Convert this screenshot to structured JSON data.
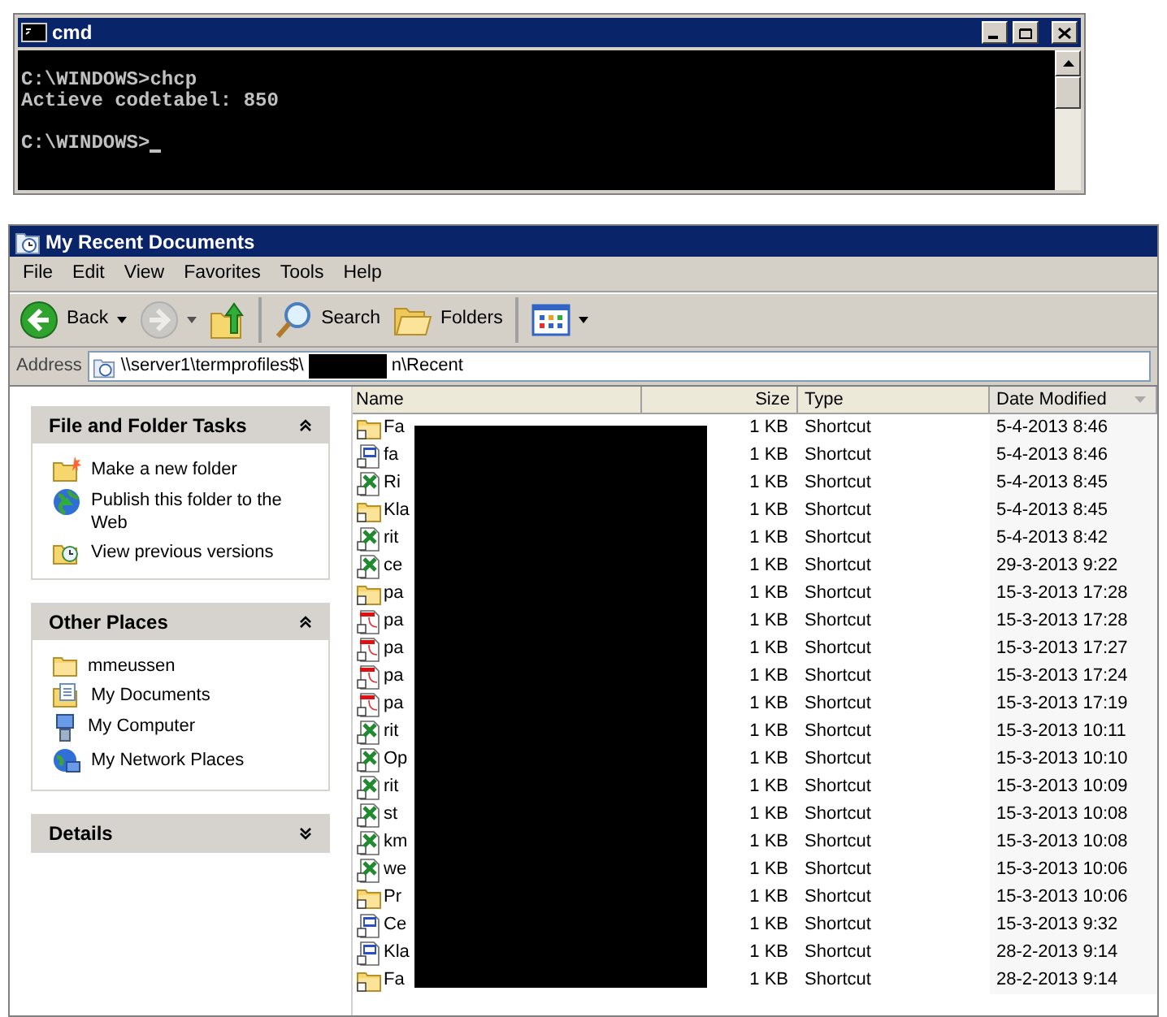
{
  "console": {
    "title": "cmd",
    "blocks": [
      [
        "C:\\WINDOWS>chcp",
        "Actieve codetabel: 850"
      ],
      [
        "C:\\WINDOWS>"
      ]
    ],
    "cursor": true
  },
  "explorer": {
    "title": "My Recent Documents",
    "menu": [
      "File",
      "Edit",
      "View",
      "Favorites",
      "Tools",
      "Help"
    ],
    "toolbar": [
      {
        "kind": "back",
        "label": "Back",
        "dropdown": true,
        "disabled": false,
        "separator_before": false
      },
      {
        "kind": "forward",
        "dropdown": true,
        "disabled": true,
        "separator_before": false
      },
      {
        "kind": "up",
        "dropdown": false,
        "disabled": false,
        "separator_before": false
      },
      {
        "kind": "search",
        "label": "Search",
        "dropdown": false,
        "disabled": false,
        "separator_before": true
      },
      {
        "kind": "folders",
        "label": "Folders",
        "dropdown": false,
        "disabled": false,
        "separator_before": false
      },
      {
        "kind": "views",
        "dropdown": true,
        "disabled": false,
        "separator_before": true
      }
    ],
    "address": {
      "label": "Address",
      "path_start": "\\\\server1\\termprofiles$\\",
      "path_end": "n\\Recent",
      "redacted": true
    },
    "task_panels": [
      {
        "title": "File and Folder Tasks",
        "expanded": true,
        "items": [
          {
            "kind": "new-folder",
            "label": "Make a new folder"
          },
          {
            "kind": "globe",
            "label": "Publish this folder to the Web"
          },
          {
            "kind": "versions",
            "label": "View previous versions"
          }
        ]
      },
      {
        "title": "Other Places",
        "expanded": true,
        "items": [
          {
            "kind": "folder",
            "label": "mmeussen"
          },
          {
            "kind": "documents",
            "label": "My Documents"
          },
          {
            "kind": "computer",
            "label": "My Computer"
          },
          {
            "kind": "network",
            "label": "My Network Places"
          }
        ]
      },
      {
        "title": "Details",
        "expanded": false
      }
    ],
    "columns": [
      {
        "label": "Name",
        "sorted": false
      },
      {
        "label": "Size",
        "sorted": false
      },
      {
        "label": "Type",
        "sorted": false
      },
      {
        "label": "Date Modified",
        "sorted": true
      }
    ],
    "names_redacted": true,
    "rows": [
      {
        "kind": "folder",
        "name": "Fa",
        "size": "1 KB",
        "type": "Shortcut",
        "modified": "5-4-2013 8:46"
      },
      {
        "kind": "web",
        "name": "fa",
        "size": "1 KB",
        "type": "Shortcut",
        "modified": "5-4-2013 8:46"
      },
      {
        "kind": "sheet",
        "name": "Ri",
        "size": "1 KB",
        "type": "Shortcut",
        "modified": "5-4-2013 8:45"
      },
      {
        "kind": "folder",
        "name": "Kla",
        "size": "1 KB",
        "type": "Shortcut",
        "modified": "5-4-2013 8:45"
      },
      {
        "kind": "sheet",
        "name": "rit",
        "size": "1 KB",
        "type": "Shortcut",
        "modified": "5-4-2013 8:42"
      },
      {
        "kind": "sheet",
        "name": "ce",
        "size": "1 KB",
        "type": "Shortcut",
        "modified": "29-3-2013 9:22"
      },
      {
        "kind": "folder",
        "name": "pa",
        "size": "1 KB",
        "type": "Shortcut",
        "modified": "15-3-2013 17:28"
      },
      {
        "kind": "pdf",
        "name": "pa",
        "size": "1 KB",
        "type": "Shortcut",
        "modified": "15-3-2013 17:28"
      },
      {
        "kind": "pdf",
        "name": "pa",
        "size": "1 KB",
        "type": "Shortcut",
        "modified": "15-3-2013 17:27"
      },
      {
        "kind": "pdf",
        "name": "pa",
        "size": "1 KB",
        "type": "Shortcut",
        "modified": "15-3-2013 17:24"
      },
      {
        "kind": "pdf",
        "name": "pa",
        "size": "1 KB",
        "type": "Shortcut",
        "modified": "15-3-2013 17:19"
      },
      {
        "kind": "sheet",
        "name": "rit",
        "size": "1 KB",
        "type": "Shortcut",
        "modified": "15-3-2013 10:11"
      },
      {
        "kind": "sheet",
        "name": "Op",
        "size": "1 KB",
        "type": "Shortcut",
        "modified": "15-3-2013 10:10"
      },
      {
        "kind": "sheet",
        "name": "rit",
        "size": "1 KB",
        "type": "Shortcut",
        "modified": "15-3-2013 10:09"
      },
      {
        "kind": "sheet",
        "name": "st",
        "size": "1 KB",
        "type": "Shortcut",
        "modified": "15-3-2013 10:08"
      },
      {
        "kind": "sheet",
        "name": "km",
        "size": "1 KB",
        "type": "Shortcut",
        "modified": "15-3-2013 10:08"
      },
      {
        "kind": "sheet",
        "name": "we",
        "size": "1 KB",
        "type": "Shortcut",
        "modified": "15-3-2013 10:06"
      },
      {
        "kind": "folder",
        "name": "Pr",
        "size": "1 KB",
        "type": "Shortcut",
        "modified": "15-3-2013 10:06"
      },
      {
        "kind": "web",
        "name": "Ce",
        "size": "1 KB",
        "type": "Shortcut",
        "modified": "15-3-2013 9:32"
      },
      {
        "kind": "web",
        "name": "Kla",
        "size": "1 KB",
        "type": "Shortcut",
        "modified": "28-2-2013 9:14"
      },
      {
        "kind": "folder",
        "name": "Fa",
        "size": "1 KB",
        "type": "Shortcut",
        "modified": "28-2-2013 9:14"
      }
    ]
  }
}
